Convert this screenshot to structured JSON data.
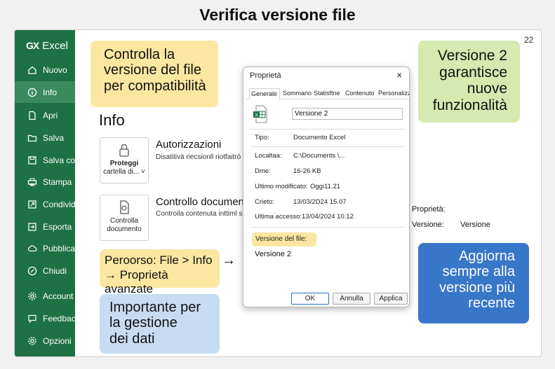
{
  "page_title": "Verifica versione file",
  "page_number": "22",
  "app": {
    "logo": "GX",
    "name": "Excel"
  },
  "sidebar": {
    "items": [
      {
        "label": "Nuovo",
        "icon": "home-icon",
        "active": false
      },
      {
        "label": "Info",
        "icon": "info-icon",
        "active": true
      },
      {
        "label": "Apri",
        "icon": "open-file-icon",
        "active": false
      },
      {
        "label": "Salva",
        "icon": "folder-icon",
        "active": false
      },
      {
        "label": "Salva con",
        "icon": "save-as-icon",
        "active": false
      },
      {
        "label": "Stampa",
        "icon": "printer-icon",
        "active": false
      },
      {
        "label": "Condividi",
        "icon": "share-icon",
        "active": false
      },
      {
        "label": "Esporta",
        "icon": "export-icon",
        "active": false
      },
      {
        "label": "Pubblica",
        "icon": "publish-icon",
        "active": false
      },
      {
        "label": "Chiudi",
        "icon": "close-circle-icon",
        "active": false
      },
      {
        "label": "Account",
        "icon": "gear-icon",
        "active": false
      },
      {
        "label": "Feedback",
        "icon": "feedback-icon",
        "active": false
      },
      {
        "label": "Opzioni",
        "icon": "settings-icon",
        "active": false
      }
    ]
  },
  "callouts": {
    "top_left": [
      "Controlla la",
      "versione del file",
      "per compatibilità"
    ],
    "top_right": [
      "Versione 2",
      "garantisce",
      "nuove",
      "funzionalità"
    ],
    "path": [
      "Peroorso: File > Info",
      "→ Proprietà avanzate"
    ],
    "important": [
      "Importante per",
      "la gestione",
      "dei dati"
    ],
    "update": [
      "Aggiorna",
      "sempre alla",
      "versione più",
      "recente"
    ]
  },
  "info": {
    "heading": "Info",
    "protect_tile": [
      "Proteggi",
      "cartella di..."
    ],
    "permissions_title": "Autorizzazioni",
    "permissions_desc": "Disatitivà riecsionll riotfaitró",
    "check_tile": [
      "Controlla",
      "documento"
    ],
    "check_title": "Controllo documen",
    "check_desc": "Controila contenuta inttiml si"
  },
  "arrow": "→",
  "dialog": {
    "title": "Proprietà",
    "close": "×",
    "tabs": [
      "Generale",
      "Sommario",
      "Statisftne",
      "Contenuto",
      "Personalizza"
    ],
    "file_name": "Versione 2",
    "properties": [
      {
        "label": "Tipo:",
        "value": "Documento Excel"
      },
      {
        "label": "Localtaa:",
        "value": "C:\\Documents \\..."
      },
      {
        "label": "Dme:",
        "value": "16-26 KB"
      },
      {
        "label": "Ultimo modificato:",
        "value": "Oggi11.21"
      },
      {
        "label": "Crieto:",
        "value": "13/03/2D24 15.07"
      },
      {
        "label": "Ultima accesso:",
        "value": "13/04/2024 10.12"
      }
    ],
    "version_label": "Versione del file:",
    "version_value": "Versione 2",
    "buttons": {
      "ok": "OK",
      "cancel": "Annulla",
      "apply": "Applica"
    }
  },
  "right_panel": {
    "title": "Proprietà:",
    "label": "Versione:",
    "value": "Versione"
  },
  "colors": {
    "sidebar": "#1e7145",
    "sidebar_active": "#3a8a5e",
    "callout_yellow": "#fbe7a1",
    "callout_green": "#d5e9b0",
    "callout_light_blue": "#c7dcf3",
    "callout_blue": "#3876c8"
  }
}
